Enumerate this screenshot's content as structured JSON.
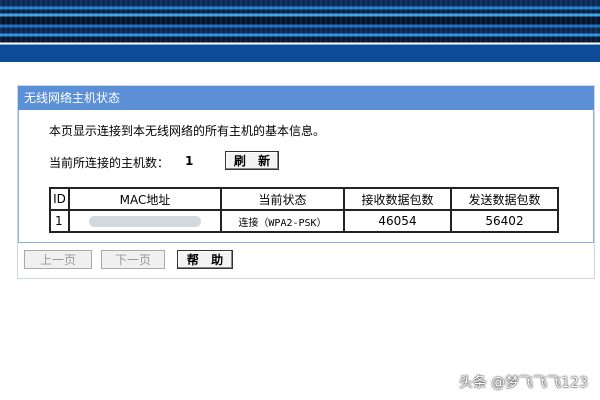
{
  "panel": {
    "title": "无线网络主机状态",
    "description": "本页显示连接到本无线网络的所有主机的基本信息。",
    "count_label": "当前所连接的主机数：",
    "count_value": "1",
    "refresh_label": "刷 新"
  },
  "table": {
    "headers": [
      "ID",
      "MAC地址",
      "当前状态",
      "接收数据包数",
      "发送数据包数"
    ],
    "rows": [
      {
        "id": "1",
        "mac": "",
        "status": "连接（WPA2-PSK）",
        "received": "46054",
        "sent": "56402"
      }
    ]
  },
  "footer": {
    "prev_label": "上一页",
    "next_label": "下一页",
    "help_label": "帮 助"
  },
  "watermark": "头条 @梦飞飞飞123",
  "colors": {
    "header_bg": "#5b8fd6",
    "banner_dark": "#0a2a55",
    "banner_blue": "#0e4c9a"
  }
}
